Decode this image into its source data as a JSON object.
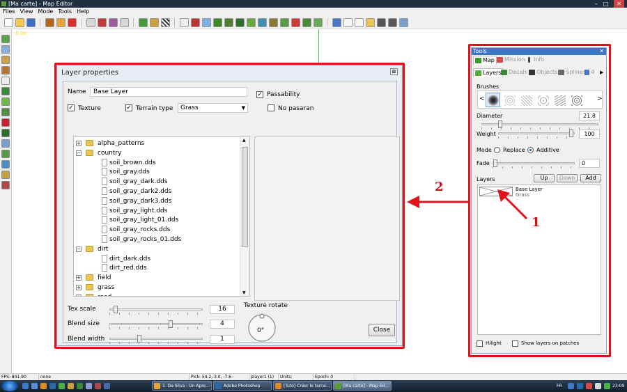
{
  "window": {
    "title": "[Ma carte] - Map Editor",
    "controls": [
      "–",
      "□",
      "✕"
    ]
  },
  "menu": [
    "Files",
    "View",
    "Mode",
    "Tools",
    "Help"
  ],
  "viewport": {
    "coord_label": "-0.00"
  },
  "layer_dialog": {
    "title": "Layer properties",
    "close_glyph": "⊠",
    "name_label": "Name",
    "name_value": "Base Layer",
    "passability_label": "Passability",
    "passability_checked": true,
    "texture_label": "Texture",
    "texture_checked": true,
    "terrain_type_label": "Terrain type",
    "terrain_type_checked": true,
    "terrain_type_value": "Grass",
    "no_pasaran_label": "No pasaran",
    "no_pasaran_checked": false,
    "tree": [
      {
        "label": "alpha_patterns",
        "type": "folder",
        "depth": 0,
        "expanded": false
      },
      {
        "label": "country",
        "type": "folder",
        "depth": 0,
        "expanded": true
      },
      {
        "label": "soil_brown.dds",
        "type": "file",
        "depth": 1
      },
      {
        "label": "soil_gray.dds",
        "type": "file",
        "depth": 1
      },
      {
        "label": "soil_gray_dark.dds",
        "type": "file",
        "depth": 1
      },
      {
        "label": "soil_gray_dark2.dds",
        "type": "file",
        "depth": 1
      },
      {
        "label": "soil_gray_dark3.dds",
        "type": "file",
        "depth": 1
      },
      {
        "label": "soil_gray_light.dds",
        "type": "file",
        "depth": 1
      },
      {
        "label": "soil_gray_light_01.dds",
        "type": "file",
        "depth": 1
      },
      {
        "label": "soil_gray_rocks.dds",
        "type": "file",
        "depth": 1
      },
      {
        "label": "soil_gray_rocks_01.dds",
        "type": "file",
        "depth": 1
      },
      {
        "label": "dirt",
        "type": "folder",
        "depth": 0,
        "expanded": true
      },
      {
        "label": "dirt_dark.dds",
        "type": "file",
        "depth": 1
      },
      {
        "label": "dirt_red.dds",
        "type": "file",
        "depth": 1
      },
      {
        "label": "field",
        "type": "folder",
        "depth": 0,
        "expanded": false
      },
      {
        "label": "grass",
        "type": "folder",
        "depth": 0,
        "expanded": false
      },
      {
        "label": "road",
        "type": "folder",
        "depth": 0,
        "expanded": false
      }
    ],
    "tex_scale_label": "Tex scale",
    "tex_scale_value": "16",
    "blend_size_label": "Blend size",
    "blend_size_value": "4",
    "blend_width_label": "Blend width",
    "blend_width_value": "1",
    "texture_rotate_label": "Texture rotate",
    "texture_rotate_value": "0°",
    "close_button": "Close"
  },
  "tools_panel": {
    "title": "Tools",
    "close_glyph": "✕",
    "top_tabs": [
      "Map",
      "Mission",
      "Info"
    ],
    "sub_tabs": [
      "Layers",
      "Decals",
      "Objects",
      "Splines",
      "4"
    ],
    "brushes_label": "Brushes",
    "diameter_label": "Diameter",
    "diameter_value": "21.8",
    "weight_label": "Weight",
    "weight_value": "100",
    "mode_label": "Mode",
    "mode_replace": "Replace",
    "mode_additive": "Additive",
    "mode_selected": "Additive",
    "fade_label": "Fade",
    "fade_value": "0",
    "layers_label": "Layers",
    "up_button": "Up",
    "down_button": "Down",
    "add_button": "Add",
    "layer_name": "Base Layer",
    "layer_type": "Grass",
    "hilight_label": "Hilight",
    "show_layers_label": "Show layers on patches"
  },
  "status_bar": {
    "fps": "FPS: 841.90",
    "selection": "none",
    "pick": "Pick: 54.2, 3.0, -7.6",
    "player": "player1 (1)",
    "units": "Units:",
    "epoch": "Epoch: 0"
  },
  "taskbar": {
    "tasks": [
      {
        "label": "1. Da Silva - Un Apre...",
        "active": false
      },
      {
        "label": "Adobe Photoshop",
        "active": false
      },
      {
        "label": "[Tuto] Créer le terrai...",
        "active": false
      },
      {
        "label": "[Ma carte] - Map Ed...",
        "active": true
      }
    ],
    "language": "FR",
    "clock": "23:09"
  },
  "annotations": {
    "label_1": "1",
    "label_2": "2",
    "highlight_color": "#e0121a"
  }
}
